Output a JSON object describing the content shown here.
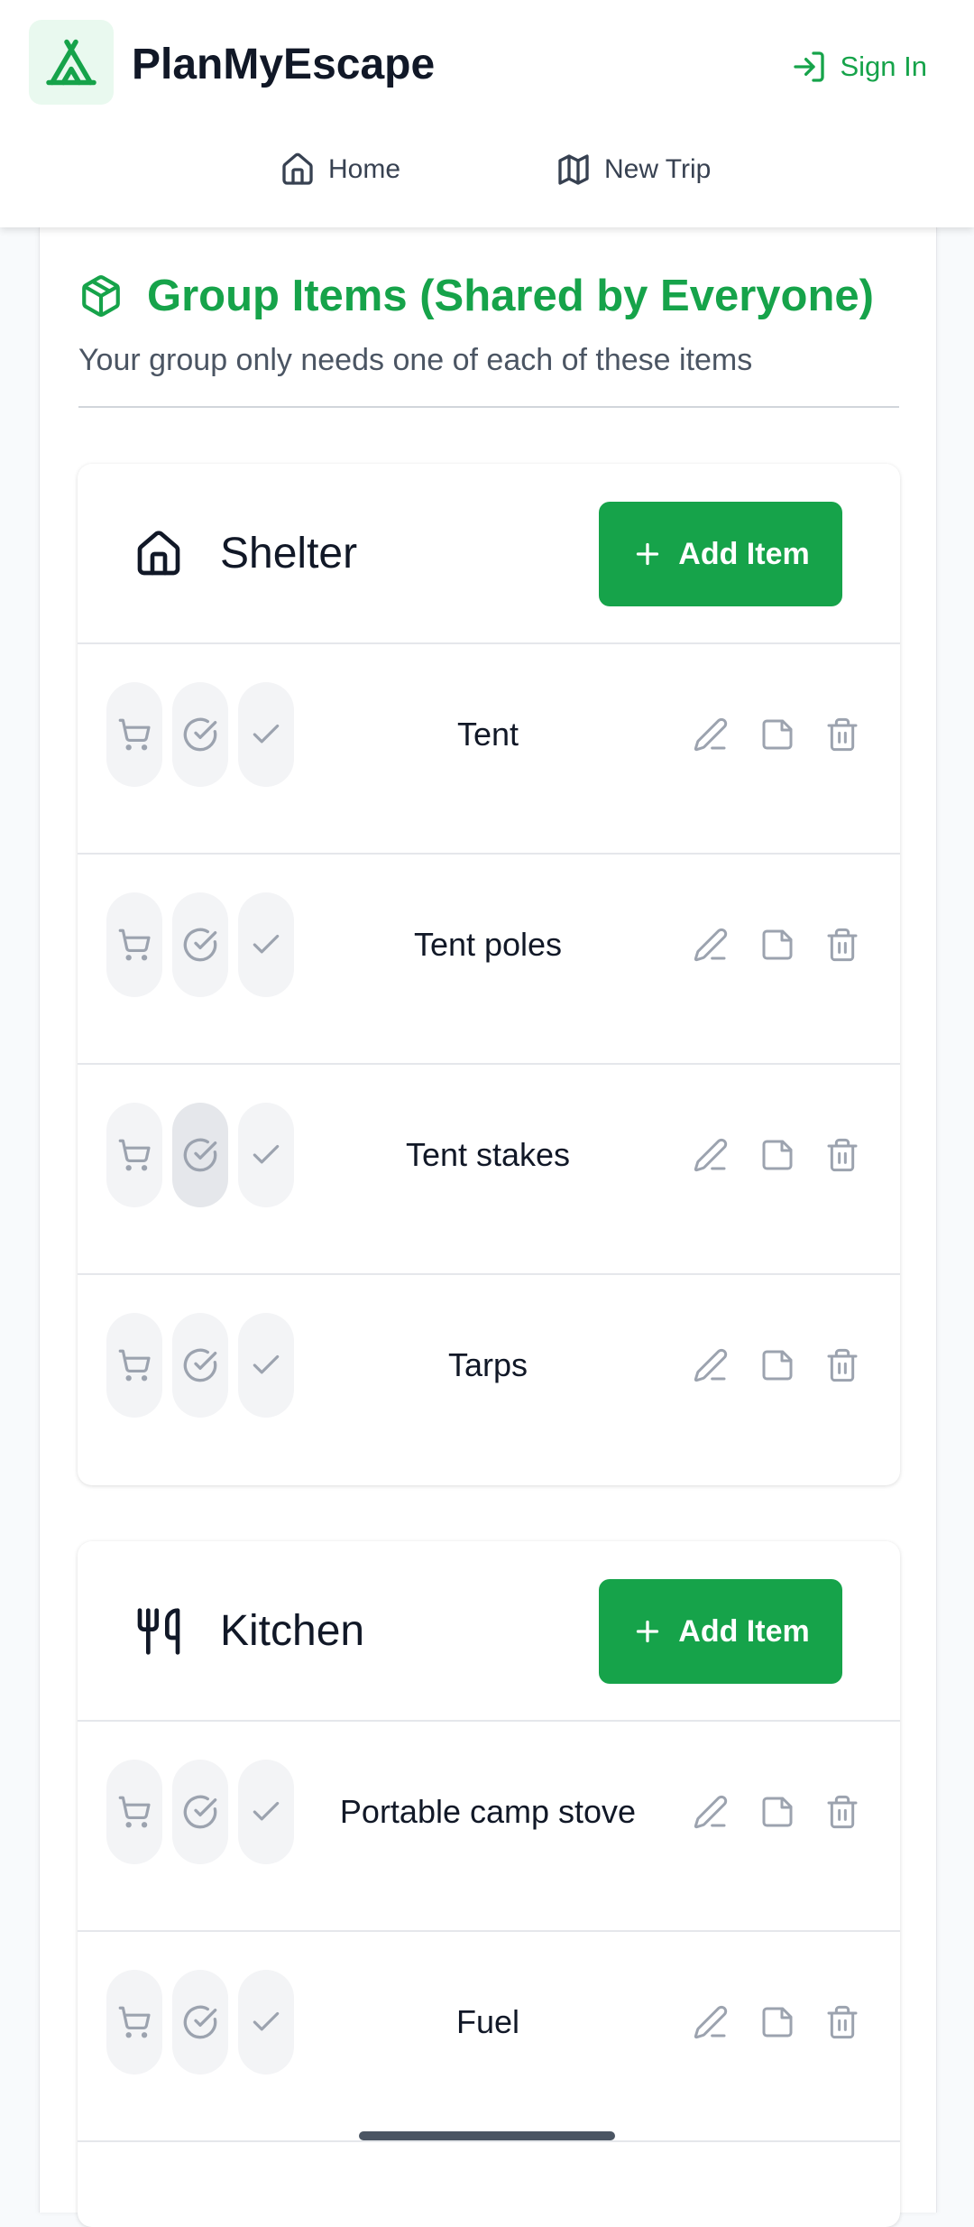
{
  "app": {
    "title": "PlanMyEscape",
    "brand_color": "#16a34a",
    "logo_icon": "tent-icon"
  },
  "header": {
    "signin_label": "Sign In",
    "nav": [
      {
        "label": "Home",
        "icon": "home-icon"
      },
      {
        "label": "New Trip",
        "icon": "map-icon"
      }
    ]
  },
  "section": {
    "title": "Group Items (Shared by Everyone)",
    "subtitle": "Your group only needs one of each of these items",
    "icon": "package-icon"
  },
  "categories": [
    {
      "name": "Shelter",
      "icon": "home-icon",
      "add_label": "Add Item",
      "items": [
        {
          "name": "Tent"
        },
        {
          "name": "Tent poles"
        },
        {
          "name": "Tent stakes"
        },
        {
          "name": "Tarps"
        }
      ]
    },
    {
      "name": "Kitchen",
      "icon": "utensils-icon",
      "add_label": "Add Item",
      "items": [
        {
          "name": "Portable camp stove"
        },
        {
          "name": "Fuel"
        }
      ]
    }
  ]
}
